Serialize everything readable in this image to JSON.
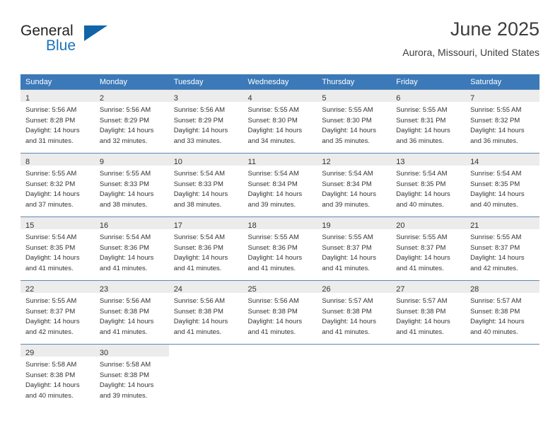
{
  "brand": {
    "name_part1": "General",
    "name_part2": "Blue",
    "accent_color": "#1164a8",
    "triangle_icon": "triangle-icon"
  },
  "header": {
    "title": "June 2025",
    "subtitle": "Aurora, Missouri, United States",
    "header_bg_color": "#3b79b8"
  },
  "weekdays": [
    "Sunday",
    "Monday",
    "Tuesday",
    "Wednesday",
    "Thursday",
    "Friday",
    "Saturday"
  ],
  "weeks": [
    [
      {
        "day": "1",
        "sunrise": "Sunrise: 5:56 AM",
        "sunset": "Sunset: 8:28 PM",
        "daylight1": "Daylight: 14 hours",
        "daylight2": "and 31 minutes."
      },
      {
        "day": "2",
        "sunrise": "Sunrise: 5:56 AM",
        "sunset": "Sunset: 8:29 PM",
        "daylight1": "Daylight: 14 hours",
        "daylight2": "and 32 minutes."
      },
      {
        "day": "3",
        "sunrise": "Sunrise: 5:56 AM",
        "sunset": "Sunset: 8:29 PM",
        "daylight1": "Daylight: 14 hours",
        "daylight2": "and 33 minutes."
      },
      {
        "day": "4",
        "sunrise": "Sunrise: 5:55 AM",
        "sunset": "Sunset: 8:30 PM",
        "daylight1": "Daylight: 14 hours",
        "daylight2": "and 34 minutes."
      },
      {
        "day": "5",
        "sunrise": "Sunrise: 5:55 AM",
        "sunset": "Sunset: 8:30 PM",
        "daylight1": "Daylight: 14 hours",
        "daylight2": "and 35 minutes."
      },
      {
        "day": "6",
        "sunrise": "Sunrise: 5:55 AM",
        "sunset": "Sunset: 8:31 PM",
        "daylight1": "Daylight: 14 hours",
        "daylight2": "and 36 minutes."
      },
      {
        "day": "7",
        "sunrise": "Sunrise: 5:55 AM",
        "sunset": "Sunset: 8:32 PM",
        "daylight1": "Daylight: 14 hours",
        "daylight2": "and 36 minutes."
      }
    ],
    [
      {
        "day": "8",
        "sunrise": "Sunrise: 5:55 AM",
        "sunset": "Sunset: 8:32 PM",
        "daylight1": "Daylight: 14 hours",
        "daylight2": "and 37 minutes."
      },
      {
        "day": "9",
        "sunrise": "Sunrise: 5:55 AM",
        "sunset": "Sunset: 8:33 PM",
        "daylight1": "Daylight: 14 hours",
        "daylight2": "and 38 minutes."
      },
      {
        "day": "10",
        "sunrise": "Sunrise: 5:54 AM",
        "sunset": "Sunset: 8:33 PM",
        "daylight1": "Daylight: 14 hours",
        "daylight2": "and 38 minutes."
      },
      {
        "day": "11",
        "sunrise": "Sunrise: 5:54 AM",
        "sunset": "Sunset: 8:34 PM",
        "daylight1": "Daylight: 14 hours",
        "daylight2": "and 39 minutes."
      },
      {
        "day": "12",
        "sunrise": "Sunrise: 5:54 AM",
        "sunset": "Sunset: 8:34 PM",
        "daylight1": "Daylight: 14 hours",
        "daylight2": "and 39 minutes."
      },
      {
        "day": "13",
        "sunrise": "Sunrise: 5:54 AM",
        "sunset": "Sunset: 8:35 PM",
        "daylight1": "Daylight: 14 hours",
        "daylight2": "and 40 minutes."
      },
      {
        "day": "14",
        "sunrise": "Sunrise: 5:54 AM",
        "sunset": "Sunset: 8:35 PM",
        "daylight1": "Daylight: 14 hours",
        "daylight2": "and 40 minutes."
      }
    ],
    [
      {
        "day": "15",
        "sunrise": "Sunrise: 5:54 AM",
        "sunset": "Sunset: 8:35 PM",
        "daylight1": "Daylight: 14 hours",
        "daylight2": "and 41 minutes."
      },
      {
        "day": "16",
        "sunrise": "Sunrise: 5:54 AM",
        "sunset": "Sunset: 8:36 PM",
        "daylight1": "Daylight: 14 hours",
        "daylight2": "and 41 minutes."
      },
      {
        "day": "17",
        "sunrise": "Sunrise: 5:54 AM",
        "sunset": "Sunset: 8:36 PM",
        "daylight1": "Daylight: 14 hours",
        "daylight2": "and 41 minutes."
      },
      {
        "day": "18",
        "sunrise": "Sunrise: 5:55 AM",
        "sunset": "Sunset: 8:36 PM",
        "daylight1": "Daylight: 14 hours",
        "daylight2": "and 41 minutes."
      },
      {
        "day": "19",
        "sunrise": "Sunrise: 5:55 AM",
        "sunset": "Sunset: 8:37 PM",
        "daylight1": "Daylight: 14 hours",
        "daylight2": "and 41 minutes."
      },
      {
        "day": "20",
        "sunrise": "Sunrise: 5:55 AM",
        "sunset": "Sunset: 8:37 PM",
        "daylight1": "Daylight: 14 hours",
        "daylight2": "and 41 minutes."
      },
      {
        "day": "21",
        "sunrise": "Sunrise: 5:55 AM",
        "sunset": "Sunset: 8:37 PM",
        "daylight1": "Daylight: 14 hours",
        "daylight2": "and 42 minutes."
      }
    ],
    [
      {
        "day": "22",
        "sunrise": "Sunrise: 5:55 AM",
        "sunset": "Sunset: 8:37 PM",
        "daylight1": "Daylight: 14 hours",
        "daylight2": "and 42 minutes."
      },
      {
        "day": "23",
        "sunrise": "Sunrise: 5:56 AM",
        "sunset": "Sunset: 8:38 PM",
        "daylight1": "Daylight: 14 hours",
        "daylight2": "and 41 minutes."
      },
      {
        "day": "24",
        "sunrise": "Sunrise: 5:56 AM",
        "sunset": "Sunset: 8:38 PM",
        "daylight1": "Daylight: 14 hours",
        "daylight2": "and 41 minutes."
      },
      {
        "day": "25",
        "sunrise": "Sunrise: 5:56 AM",
        "sunset": "Sunset: 8:38 PM",
        "daylight1": "Daylight: 14 hours",
        "daylight2": "and 41 minutes."
      },
      {
        "day": "26",
        "sunrise": "Sunrise: 5:57 AM",
        "sunset": "Sunset: 8:38 PM",
        "daylight1": "Daylight: 14 hours",
        "daylight2": "and 41 minutes."
      },
      {
        "day": "27",
        "sunrise": "Sunrise: 5:57 AM",
        "sunset": "Sunset: 8:38 PM",
        "daylight1": "Daylight: 14 hours",
        "daylight2": "and 41 minutes."
      },
      {
        "day": "28",
        "sunrise": "Sunrise: 5:57 AM",
        "sunset": "Sunset: 8:38 PM",
        "daylight1": "Daylight: 14 hours",
        "daylight2": "and 40 minutes."
      }
    ],
    [
      {
        "day": "29",
        "sunrise": "Sunrise: 5:58 AM",
        "sunset": "Sunset: 8:38 PM",
        "daylight1": "Daylight: 14 hours",
        "daylight2": "and 40 minutes."
      },
      {
        "day": "30",
        "sunrise": "Sunrise: 5:58 AM",
        "sunset": "Sunset: 8:38 PM",
        "daylight1": "Daylight: 14 hours",
        "daylight2": "and 39 minutes."
      },
      {
        "day": "",
        "sunrise": "",
        "sunset": "",
        "daylight1": "",
        "daylight2": ""
      },
      {
        "day": "",
        "sunrise": "",
        "sunset": "",
        "daylight1": "",
        "daylight2": ""
      },
      {
        "day": "",
        "sunrise": "",
        "sunset": "",
        "daylight1": "",
        "daylight2": ""
      },
      {
        "day": "",
        "sunrise": "",
        "sunset": "",
        "daylight1": "",
        "daylight2": ""
      },
      {
        "day": "",
        "sunrise": "",
        "sunset": "",
        "daylight1": "",
        "daylight2": ""
      }
    ]
  ]
}
